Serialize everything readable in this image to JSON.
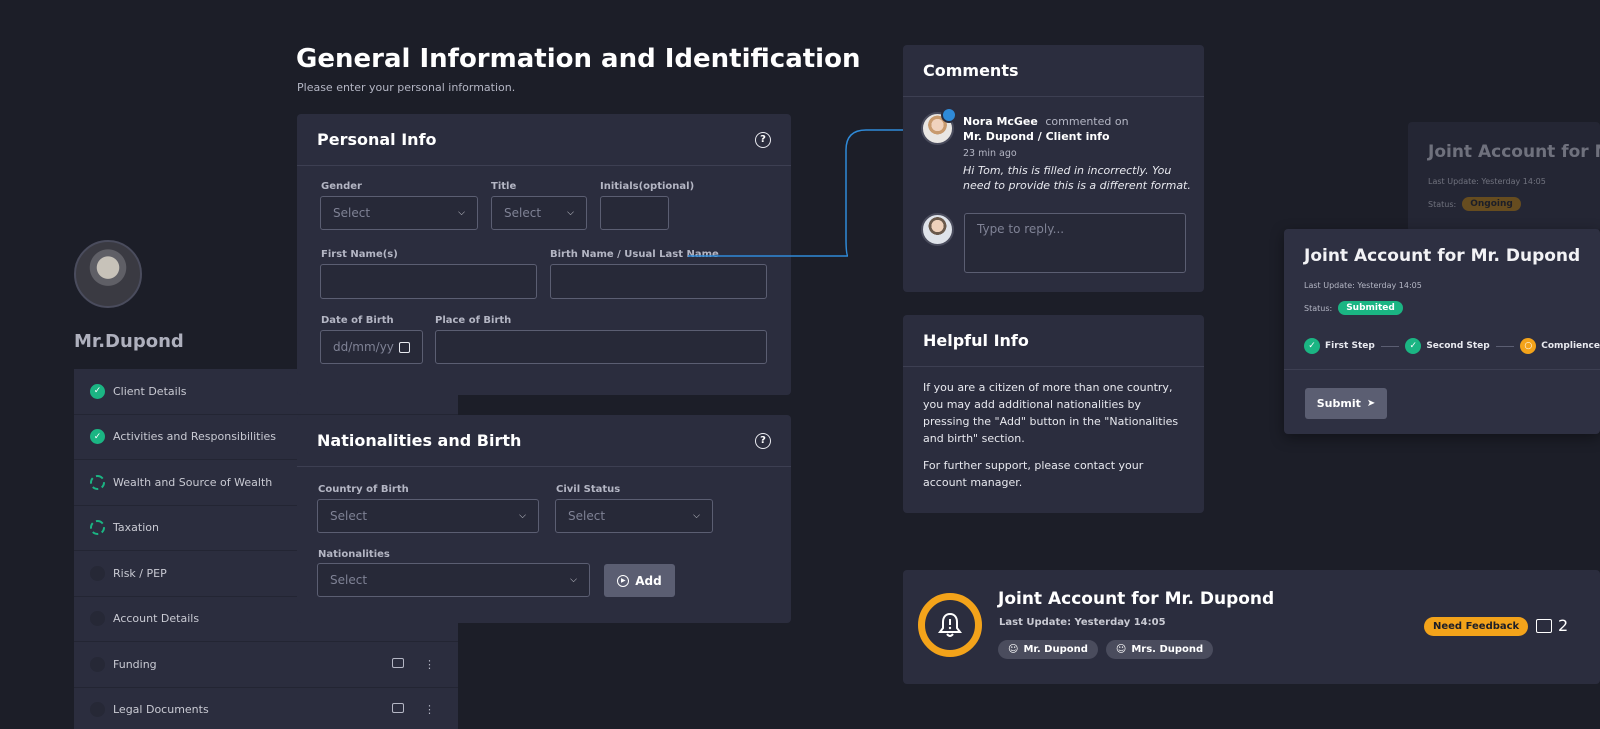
{
  "page": {
    "title": "General Information and Identification",
    "subtitle": "Please enter your personal information."
  },
  "profile": {
    "name": "Mr.Dupond"
  },
  "steps": [
    {
      "label": "Client Details",
      "state": "done"
    },
    {
      "label": "Activities and Responsibilities",
      "state": "done"
    },
    {
      "label": "Wealth and Source of Wealth",
      "state": "progress"
    },
    {
      "label": "Taxation",
      "state": "progress"
    },
    {
      "label": "Risk / PEP",
      "state": "empty"
    },
    {
      "label": "Account Details",
      "state": "empty"
    },
    {
      "label": "Funding",
      "state": "empty"
    },
    {
      "label": "Legal Documents",
      "state": "empty"
    }
  ],
  "personal_info": {
    "title": "Personal Info",
    "help_icon": "?",
    "gender": {
      "label": "Gender",
      "placeholder": "Select"
    },
    "title_field": {
      "label": "Title",
      "placeholder": "Select"
    },
    "initials": {
      "label": "Initials(optional)",
      "value": ""
    },
    "first_name": {
      "label": "First Name(s)",
      "value": ""
    },
    "birth_name": {
      "label": "Birth Name / Usual Last Name",
      "value": ""
    },
    "dob": {
      "label": "Date of Birth",
      "placeholder": "dd/mm/yy"
    },
    "pob": {
      "label": "Place of Birth",
      "value": ""
    }
  },
  "nationalities": {
    "title": "Nationalities and Birth",
    "help_icon": "?",
    "country": {
      "label": "Country of Birth",
      "placeholder": "Select"
    },
    "civil": {
      "label": "Civil Status",
      "placeholder": "Select"
    },
    "nat": {
      "label": "Nationalities",
      "placeholder": "Select"
    },
    "add_label": "Add"
  },
  "comments": {
    "title": "Comments",
    "author": "Nora McGee",
    "action": "commented on",
    "target": "Mr. Dupond / Client info",
    "time": "23 min ago",
    "text": "Hi Tom, this is filled in incorrectly. You need to provide this is a different format.",
    "reply_placeholder": "Type to reply..."
  },
  "helpful": {
    "title": "Helpful Info",
    "p1": "If you are a citizen of more than one country, you may add additional nationalities by pressing the \"Add\" button in the \"Nationalities and birth\" section.",
    "p2": "For further support, please contact your account manager."
  },
  "joint_back": {
    "title": "Joint Account for M",
    "update": "Last Update: Yesterday 14:05",
    "status_label": "Status:",
    "status": "Ongoing"
  },
  "joint_mid": {
    "title": "Joint Account for Mr. Dupond",
    "update": "Last Update: Yesterday 14:05",
    "status_label": "Status:",
    "status": "Submited",
    "stages": [
      "First Step",
      "Second Step",
      "Complience"
    ],
    "submit": "Submit"
  },
  "notify": {
    "title": "Joint Account for Mr. Dupond",
    "update": "Last Update: Yesterday 14:05",
    "people": [
      "Mr. Dupond",
      "Mrs. Dupond"
    ],
    "badge": "Need Feedback",
    "count": "2"
  },
  "colors": {
    "accent_green": "#1bb583",
    "accent_orange": "#f3a31a",
    "link_blue": "#2f8ad8"
  }
}
